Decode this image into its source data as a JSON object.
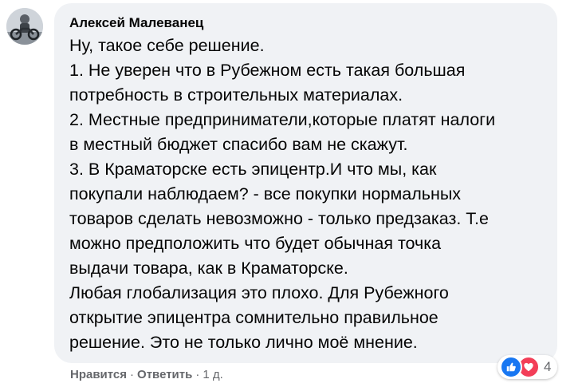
{
  "author": {
    "name": "Алексей Малеванец"
  },
  "comment": {
    "lines": [
      "Ну, такое себе решение.",
      "1. Не уверен что в Рубежном есть такая большая",
      "потребность в строительных материалах.",
      "2. Местные предприниматели,которые платят налоги",
      "в местный бюджет спасибо вам не скажут.",
      "3. В Краматорске есть эпицентр.И что мы, как",
      "покупали наблюдаем? - все покупки нормальных",
      "товаров сделать невозможно - только предзаказ. Т.е",
      "можно предположить что будет обычная точка",
      "выдачи товара, как в Краматорске.",
      "Любая глобализация это плохо. Для Рубежного",
      "открытие эпицентра сомнительно правильное",
      "решение. Это не только лично моё мнение."
    ]
  },
  "actions": {
    "like_label": "Нравится",
    "separator": "·",
    "reply_label": "Ответить",
    "timestamp": "1 д."
  },
  "reactions": {
    "icons": [
      "like-icon",
      "love-icon"
    ],
    "count": "4",
    "colors": {
      "like": "#1877f2",
      "love": "#f33e58"
    }
  },
  "colors": {
    "bubble_background": "#f0f2f5",
    "secondary_text": "#65676b",
    "primary_text": "#050505"
  }
}
